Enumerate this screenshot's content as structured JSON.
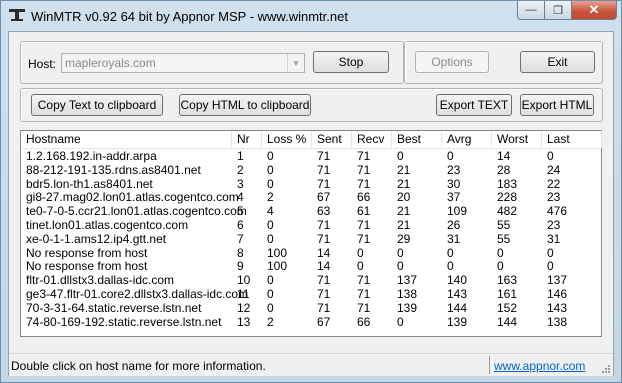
{
  "window": {
    "title": "WinMTR v0.92 64 bit by Appnor MSP - www.winmtr.net"
  },
  "titlebar_buttons": {
    "minimize": "—",
    "maximize": "❐",
    "close": "✕"
  },
  "host_panel": {
    "label": "Host:",
    "value": "mapleroyals.com",
    "stop_label": "Stop"
  },
  "options_panel": {
    "options_label": "Options",
    "exit_label": "Exit"
  },
  "export_panel": {
    "copy_text_label": "Copy Text to clipboard",
    "copy_html_label": "Copy HTML to clipboard",
    "export_text_label": "Export TEXT",
    "export_html_label": "Export HTML"
  },
  "table": {
    "columns": [
      "Hostname",
      "Nr",
      "Loss %",
      "Sent",
      "Recv",
      "Best",
      "Avrg",
      "Worst",
      "Last"
    ],
    "rows": [
      [
        "1.2.168.192.in-addr.arpa",
        "1",
        "0",
        "71",
        "71",
        "0",
        "0",
        "14",
        "0"
      ],
      [
        "88-212-191-135.rdns.as8401.net",
        "2",
        "0",
        "71",
        "71",
        "21",
        "23",
        "28",
        "24"
      ],
      [
        "bdr5.lon-th1.as8401.net",
        "3",
        "0",
        "71",
        "71",
        "21",
        "30",
        "183",
        "22"
      ],
      [
        "gi8-27.mag02.lon01.atlas.cogentco.com",
        "4",
        "2",
        "67",
        "66",
        "20",
        "37",
        "228",
        "23"
      ],
      [
        "te0-7-0-5.ccr21.lon01.atlas.cogentco.com",
        "5",
        "4",
        "63",
        "61",
        "21",
        "109",
        "482",
        "476"
      ],
      [
        "tinet.lon01.atlas.cogentco.com",
        "6",
        "0",
        "71",
        "71",
        "21",
        "26",
        "55",
        "23"
      ],
      [
        "xe-0-1-1.ams12.ip4.gtt.net",
        "7",
        "0",
        "71",
        "71",
        "29",
        "31",
        "55",
        "31"
      ],
      [
        "No response from host",
        "8",
        "100",
        "14",
        "0",
        "0",
        "0",
        "0",
        "0"
      ],
      [
        "No response from host",
        "9",
        "100",
        "14",
        "0",
        "0",
        "0",
        "0",
        "0"
      ],
      [
        "fltr-01.dllstx3.dallas-idc.com",
        "10",
        "0",
        "71",
        "71",
        "137",
        "140",
        "163",
        "137"
      ],
      [
        "ge3-47.fltr-01.core2.dllstx3.dallas-idc.com",
        "11",
        "0",
        "71",
        "71",
        "138",
        "143",
        "161",
        "146"
      ],
      [
        "70-3-31-64.static.reverse.lstn.net",
        "12",
        "0",
        "71",
        "71",
        "139",
        "144",
        "152",
        "143"
      ],
      [
        "74-80-169-192.static.reverse.lstn.net",
        "13",
        "2",
        "67",
        "66",
        "0",
        "139",
        "144",
        "138"
      ]
    ]
  },
  "statusbar": {
    "message": "Double click on host name for more information.",
    "link": "www.appnor.com"
  },
  "icons": {
    "app": "winmtr-app-icon",
    "combo": "chevron-down-icon",
    "grip": "resize-grip-icon"
  }
}
